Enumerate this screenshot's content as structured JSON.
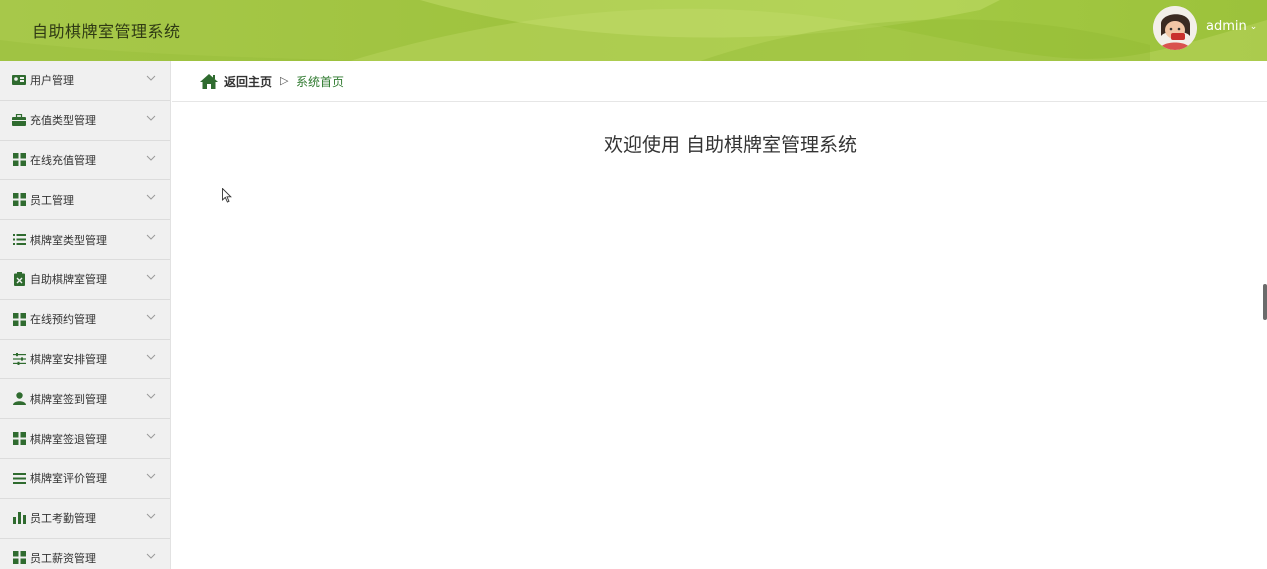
{
  "header": {
    "title": "自助棋牌室管理系统",
    "username": "admin",
    "user_caret": "⌄"
  },
  "sidebar": {
    "items": [
      {
        "label": "用户管理",
        "icon": "id-card-icon"
      },
      {
        "label": "充值类型管理",
        "icon": "briefcase-icon"
      },
      {
        "label": "在线充值管理",
        "icon": "grid-icon"
      },
      {
        "label": "员工管理",
        "icon": "grid-icon"
      },
      {
        "label": "棋牌室类型管理",
        "icon": "list-icon"
      },
      {
        "label": "自助棋牌室管理",
        "icon": "clipboard-x-icon"
      },
      {
        "label": "在线预约管理",
        "icon": "grid-icon"
      },
      {
        "label": "棋牌室安排管理",
        "icon": "sliders-icon"
      },
      {
        "label": "棋牌室签到管理",
        "icon": "user-icon"
      },
      {
        "label": "棋牌室签退管理",
        "icon": "grid-icon"
      },
      {
        "label": "棋牌室评价管理",
        "icon": "list-lines-icon"
      },
      {
        "label": "员工考勤管理",
        "icon": "bar-chart-icon"
      },
      {
        "label": "员工薪资管理",
        "icon": "grid-icon"
      }
    ]
  },
  "breadcrumb": {
    "home_label": "返回主页",
    "separator": "▷",
    "current": "系统首页"
  },
  "main": {
    "welcome": "欢迎使用 自助棋牌室管理系统"
  },
  "colors": {
    "header_green": "#a3c944",
    "accent_green": "#2f6b2f",
    "sidebar_bg": "#f0f0f0"
  }
}
